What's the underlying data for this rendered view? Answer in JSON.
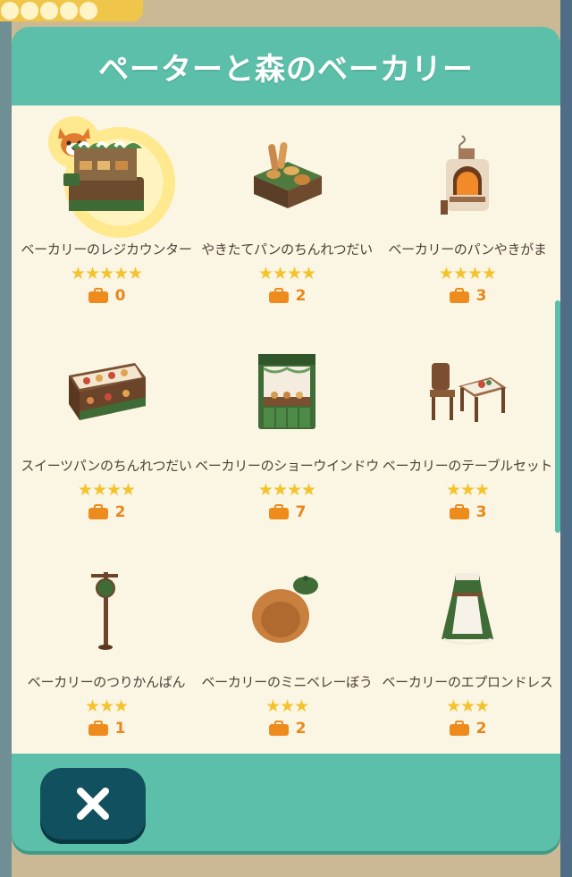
{
  "dialog": {
    "title": "ペーターと森のベーカリー",
    "accent_color": "#5cbfa9",
    "content_bg": "#fbf5e4"
  },
  "items": [
    {
      "name": "ベーカリーのレジカウンター",
      "stars": "★★★★★",
      "rating": 5,
      "count": "0",
      "icon": "bakery-register-counter-icon",
      "featured": true
    },
    {
      "name": "やきたてパンのちんれつだい",
      "stars": "★★★★",
      "rating": 4,
      "count": "2",
      "icon": "fresh-bread-display-icon"
    },
    {
      "name": "ベーカリーのパンやきがま",
      "stars": "★★★★",
      "rating": 4,
      "count": "3",
      "icon": "bread-oven-icon"
    },
    {
      "name": "スイーツパンのちんれつだい",
      "stars": "★★★★",
      "rating": 4,
      "count": "2",
      "icon": "sweets-bread-display-icon"
    },
    {
      "name": "ベーカリーのショーウインドウ",
      "stars": "★★★★",
      "rating": 4,
      "count": "7",
      "icon": "bakery-show-window-icon"
    },
    {
      "name": "ベーカリーのテーブルセット",
      "stars": "★★★",
      "rating": 3,
      "count": "3",
      "icon": "bakery-table-set-icon"
    },
    {
      "name": "ベーカリーのつりかんばん",
      "stars": "★★★",
      "rating": 3,
      "count": "1",
      "icon": "hanging-sign-icon"
    },
    {
      "name": "ベーカリーのミニベレーぼう",
      "stars": "★★★",
      "rating": 3,
      "count": "2",
      "icon": "mini-beret-icon"
    },
    {
      "name": "ベーカリーのエプロンドレス",
      "stars": "★★★",
      "rating": 3,
      "count": "2",
      "icon": "apron-dress-icon"
    }
  ],
  "close_button": {
    "icon": "close-icon"
  }
}
